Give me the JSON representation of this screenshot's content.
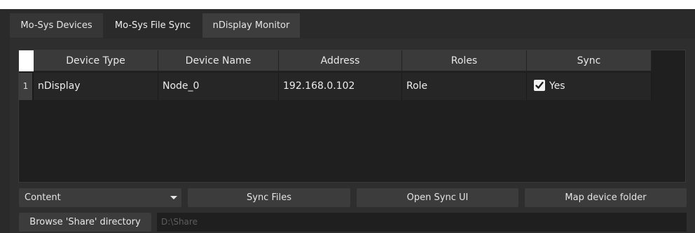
{
  "tabs": [
    {
      "label": "Mo-Sys Devices"
    },
    {
      "label": "Mo-Sys File Sync",
      "active": true
    },
    {
      "label": "nDisplay Monitor"
    }
  ],
  "table": {
    "columns": [
      "Device Type",
      "Device Name",
      "Address",
      "Roles",
      "Sync"
    ],
    "rows": [
      {
        "row_number": "1",
        "device_type": "nDisplay",
        "device_name": "Node_0",
        "address": "192.168.0.102",
        "roles": "Role",
        "sync_checked": true,
        "sync_label": "Yes"
      }
    ]
  },
  "controls": {
    "content_dropdown": "Content",
    "sync_files": "Sync Files",
    "open_sync_ui": "Open Sync UI",
    "map_device_folder": "Map device folder",
    "browse_share": "Browse 'Share' directory",
    "share_path": "D:\\Share"
  },
  "colors": {
    "background": "#2a2a2a",
    "panel": "#2e2e2e",
    "button": "#3c3c3c",
    "table_bg": "#1f1f1f"
  }
}
